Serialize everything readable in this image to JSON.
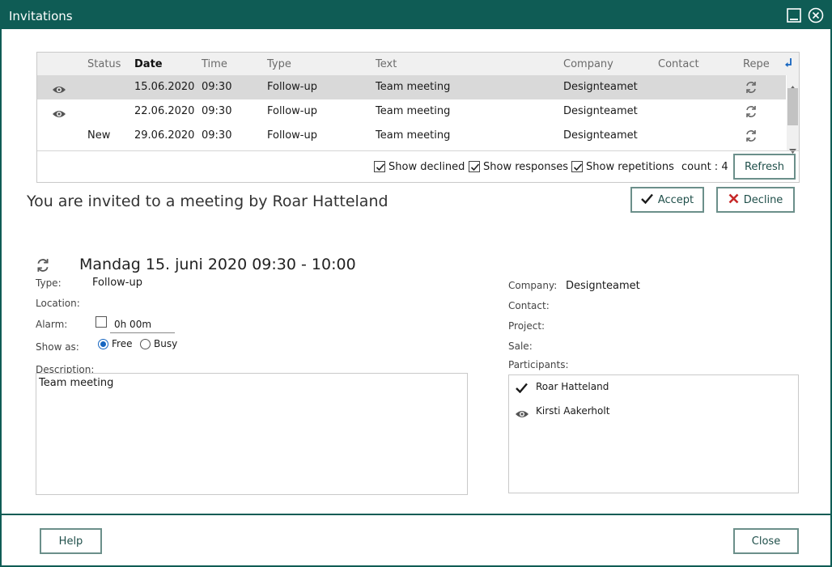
{
  "window": {
    "title": "Invitations"
  },
  "grid": {
    "columns": {
      "status": "Status",
      "date": "Date",
      "time": "Time",
      "type": "Type",
      "text": "Text",
      "company": "Company",
      "contact": "Contact",
      "repeat": "Repe"
    },
    "rows": [
      {
        "icon": "eye-icon",
        "status": "",
        "date": "15.06.2020",
        "time": "09:30",
        "type": "Follow-up",
        "text": "Team meeting",
        "company": "Designteamet",
        "contact": "",
        "repeat_icon": "repeat-icon"
      },
      {
        "icon": "eye-icon",
        "status": "",
        "date": "22.06.2020",
        "time": "09:30",
        "type": "Follow-up",
        "text": "Team meeting",
        "company": "Designteamet",
        "contact": "",
        "repeat_icon": "repeat-icon"
      },
      {
        "icon": "",
        "status": "New",
        "date": "29.06.2020",
        "time": "09:30",
        "type": "Follow-up",
        "text": "Team meeting",
        "company": "Designteamet",
        "contact": "",
        "repeat_icon": "repeat-icon"
      }
    ],
    "filters": {
      "show_declined": "Show declined",
      "show_responses": "Show responses",
      "show_repetitions": "Show repetitions",
      "declined_checked": true,
      "responses_checked": true,
      "repetitions_checked": true
    },
    "count": "count : 4",
    "refresh": "Refresh"
  },
  "invite": {
    "heading": "You are invited to a meeting by Roar Hatteland",
    "accept": "Accept",
    "decline": "Decline"
  },
  "detail": {
    "datetime": "Mandag 15. juni 2020 09:30 - 10:00",
    "type_label": "Type:",
    "type_value": "Follow-up",
    "location_label": "Location:",
    "alarm_label": "Alarm:",
    "alarm_value": "0h 00m",
    "show_as_label": "Show as:",
    "free": "Free",
    "busy": "Busy",
    "show_as_selected": "Free",
    "description_label": "Description:",
    "description_value": "Team meeting",
    "company_label": "Company:",
    "company_value": "Designteamet",
    "contact_label": "Contact:",
    "project_label": "Project:",
    "sale_label": "Sale:",
    "participants_label": "Participants:",
    "participants": [
      {
        "icon": "check-icon",
        "name": "Roar Hatteland"
      },
      {
        "icon": "eye-icon",
        "name": "Kirsti Aakerholt"
      }
    ]
  },
  "footer": {
    "help": "Help",
    "close": "Close"
  },
  "colors": {
    "titlebar": "#0f5c55",
    "accent_blue": "#1565c0",
    "decline_red": "#c62828"
  }
}
